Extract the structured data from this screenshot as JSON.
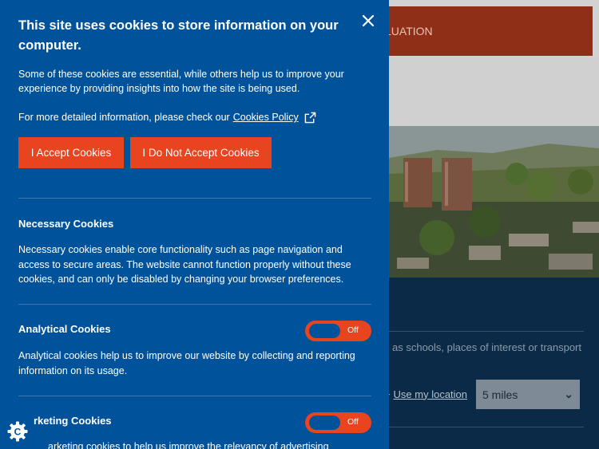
{
  "background": {
    "valuation_label": "LUATION",
    "search_hint": "as schools, places of interest or transport",
    "use_location_label": "Use my location",
    "radius_select": "5 miles"
  },
  "cookie_banner": {
    "title": "This site uses cookies to store information on your computer.",
    "intro": "Some of these cookies are essential, while others help us to improve your experience by providing insights into how the site is being used.",
    "policy_prefix": "For more detailed information, please check our",
    "policy_link": "Cookies Policy",
    "accept_label": "I Accept Cookies",
    "reject_label": "I Do Not Accept Cookies",
    "sections": [
      {
        "title": "Necessary Cookies",
        "description": "Necessary cookies enable core functionality such as page navigation and access to secure areas. The website cannot function properly without these cookies, and can only be disabled by changing your browser preferences."
      },
      {
        "title": "Analytical Cookies",
        "toggle_state": "Off",
        "description": "Analytical cookies help us to improve our website by collecting and reporting information on its usage."
      },
      {
        "title": "rketing Cookies",
        "toggle_state": "Off",
        "description": "arketing cookies to help us improve the relevancy of advertising"
      }
    ]
  },
  "colors": {
    "panel": "#00539b",
    "accent": "#e8441f"
  }
}
